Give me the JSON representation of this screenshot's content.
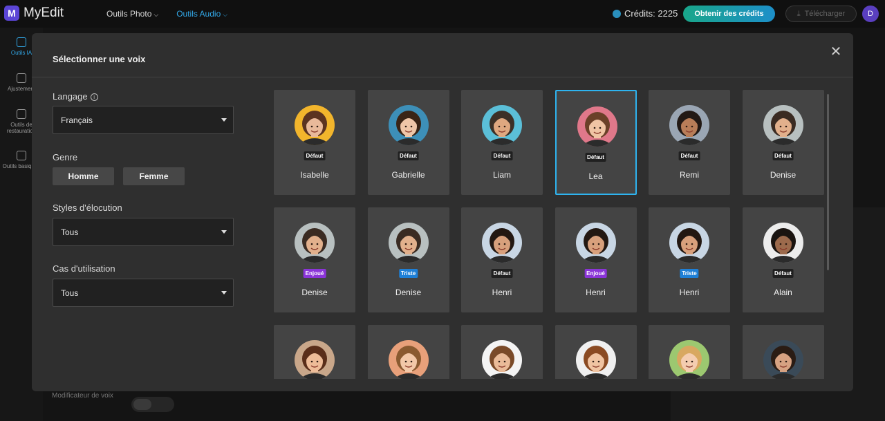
{
  "app": {
    "name": "MyEdit",
    "logo_letter": "M"
  },
  "topnav": [
    {
      "label": "Outils Photo",
      "active": false
    },
    {
      "label": "Outils Audio",
      "active": true
    }
  ],
  "header": {
    "credits": "Crédits: 2225",
    "get_credits": "Obtenir des crédits",
    "download": "Télécharger",
    "user_initial": "D"
  },
  "rail": [
    {
      "label": "Outils IA",
      "icon": "magic-wand-icon",
      "active": true
    },
    {
      "label": "Ajustement",
      "icon": "sliders-icon",
      "active": false
    },
    {
      "label": "Outils de restauration",
      "icon": "waveform-icon",
      "active": false
    },
    {
      "label": "Outils basiques",
      "icon": "crop-icon",
      "active": false
    }
  ],
  "background": {
    "voice_modifier": "Modificateur de voix"
  },
  "modal": {
    "title": "Sélectionner une voix",
    "language": {
      "label": "Langage",
      "value": "Français"
    },
    "gender": {
      "label": "Genre",
      "options": [
        "Homme",
        "Femme"
      ]
    },
    "styles": {
      "label": "Styles d'élocution",
      "value": "Tous"
    },
    "usecase": {
      "label": "Cas d'utilisation",
      "value": "Tous"
    },
    "voices": [
      {
        "name": "Isabelle",
        "badge": "Défaut",
        "kind": "default",
        "selected": false,
        "bg": "#f2b52c",
        "hair": "#5b3320",
        "skin": "#e9b99a"
      },
      {
        "name": "Gabrielle",
        "badge": "Défaut",
        "kind": "default",
        "selected": false,
        "bg": "#3d8fb8",
        "hair": "#3a2416",
        "skin": "#efc6a8"
      },
      {
        "name": "Liam",
        "badge": "Défaut",
        "kind": "default",
        "selected": false,
        "bg": "#5bbfd8",
        "hair": "#3c3027",
        "skin": "#dfa880"
      },
      {
        "name": "Lea",
        "badge": "Défaut",
        "kind": "default",
        "selected": true,
        "bg": "#e0788a",
        "hair": "#6b4028",
        "skin": "#f0c4a4"
      },
      {
        "name": "Remi",
        "badge": "Défaut",
        "kind": "default",
        "selected": false,
        "bg": "#9aa6b4",
        "hair": "#221915",
        "skin": "#b87d58"
      },
      {
        "name": "Denise",
        "badge": "Défaut",
        "kind": "default",
        "selected": false,
        "bg": "#b8c0c0",
        "hair": "#3a2b22",
        "skin": "#e2b08c"
      },
      {
        "name": "Denise",
        "badge": "Enjoué",
        "kind": "enjoue",
        "selected": false,
        "bg": "#b8c0c0",
        "hair": "#3a2b22",
        "skin": "#e2b08c"
      },
      {
        "name": "Denise",
        "badge": "Triste",
        "kind": "triste",
        "selected": false,
        "bg": "#b8c0c0",
        "hair": "#3a2b22",
        "skin": "#e2b08c"
      },
      {
        "name": "Henri",
        "badge": "Défaut",
        "kind": "default",
        "selected": false,
        "bg": "#c8d6e4",
        "hair": "#231812",
        "skin": "#d8a07c"
      },
      {
        "name": "Henri",
        "badge": "Enjoué",
        "kind": "enjoue",
        "selected": false,
        "bg": "#c8d6e4",
        "hair": "#231812",
        "skin": "#d8a07c"
      },
      {
        "name": "Henri",
        "badge": "Triste",
        "kind": "triste",
        "selected": false,
        "bg": "#c8d6e4",
        "hair": "#231812",
        "skin": "#d8a07c"
      },
      {
        "name": "Alain",
        "badge": "Défaut",
        "kind": "default",
        "selected": false,
        "bg": "#ececec",
        "hair": "#1a1410",
        "skin": "#9c6a4c"
      },
      {
        "name": "",
        "badge": "",
        "kind": "none",
        "selected": false,
        "bg": "#c9a78a",
        "hair": "#5a2e1a",
        "skin": "#eebc98"
      },
      {
        "name": "",
        "badge": "",
        "kind": "none",
        "selected": false,
        "bg": "#e8a07a",
        "hair": "#8a5a30",
        "skin": "#f2c8a8"
      },
      {
        "name": "",
        "badge": "",
        "kind": "none",
        "selected": false,
        "bg": "#f4f4f4",
        "hair": "#7a4a28",
        "skin": "#eabb98"
      },
      {
        "name": "",
        "badge": "",
        "kind": "none",
        "selected": false,
        "bg": "#f0f0f0",
        "hair": "#8a4a22",
        "skin": "#f0c4a2"
      },
      {
        "name": "",
        "badge": "",
        "kind": "none",
        "selected": false,
        "bg": "#9cc870",
        "hair": "#d8a860",
        "skin": "#f4cdb0"
      },
      {
        "name": "",
        "badge": "",
        "kind": "none",
        "selected": false,
        "bg": "#3a4a58",
        "hair": "#2a1c14",
        "skin": "#d6a282"
      }
    ]
  }
}
